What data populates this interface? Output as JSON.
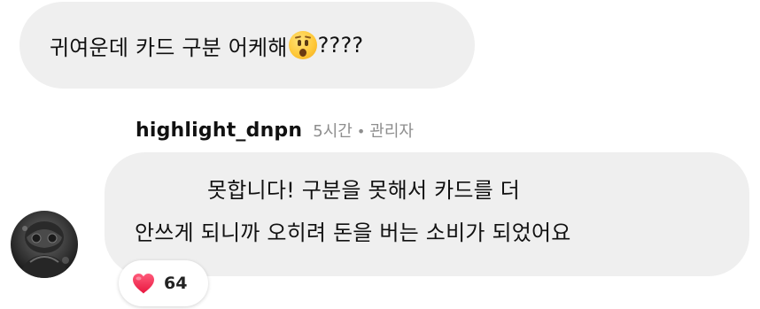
{
  "comment": {
    "text": "귀여운데 카드 구분 어케해",
    "emoji": "hushed-face-emoji",
    "suffix": "????"
  },
  "reply": {
    "username": "highlight_dnpn",
    "time": "5시간",
    "separator": "•",
    "role": "관리자",
    "line1": "못합니다! 구분을 못해서 카드를 더",
    "line2": "안쓰게 되니까 오히려 돈을 버는 소비가 되었어요",
    "reaction_icon": "heart-icon",
    "reaction_count": "64",
    "heart_color": "#f0264f"
  },
  "colors": {
    "bubble": "#efefef",
    "text": "#111111",
    "muted": "#8e8e8e"
  }
}
